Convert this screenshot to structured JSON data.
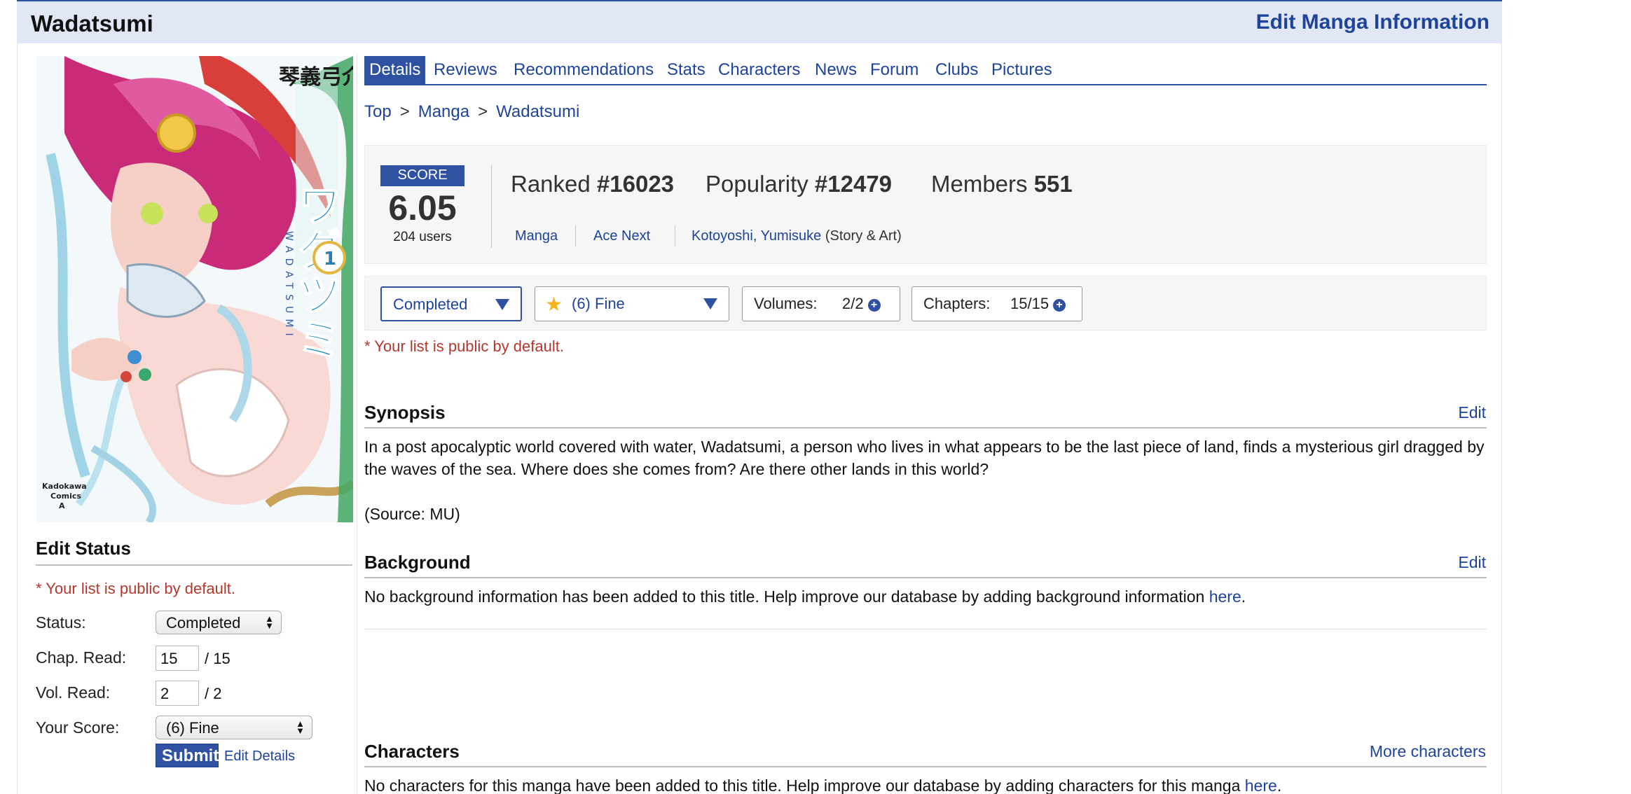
{
  "header": {
    "title": "Wadatsumi",
    "edit_link": "Edit Manga Information"
  },
  "cover": {
    "jp_title": "ワダツミ",
    "jp_author": "琴義弓介",
    "romaji": "WADATSUMI",
    "volume": "1",
    "publisher_mark": "Kadokawa Comics A",
    "colors": {
      "hair": "#c8287a",
      "skin": "#f5c6c0",
      "water": "#a9dcea",
      "title_green": "#37a85a"
    }
  },
  "tabs": [
    "Details",
    "Reviews",
    "Recommendations",
    "Stats",
    "Characters",
    "News",
    "Forum",
    "Clubs",
    "Pictures"
  ],
  "breadcrumb": [
    "Top",
    "Manga",
    "Wadatsumi"
  ],
  "stats": {
    "score_label": "SCORE",
    "score": "6.05",
    "users": "204 users",
    "ranked_label": "Ranked",
    "ranked": "#16023",
    "popularity_label": "Popularity",
    "popularity": "#12479",
    "members_label": "Members",
    "members": "551",
    "type": "Manga",
    "serialization": "Ace Next",
    "author": "Kotoyoshi, Yumisuke",
    "author_role": "(Story & Art)"
  },
  "list_bar": {
    "status": "Completed",
    "score": "(6) Fine",
    "volumes_label": "Volumes:",
    "volumes": "2/2",
    "chapters_label": "Chapters:",
    "chapters": "15/15"
  },
  "public_note": "* Your list is public by default.",
  "synopsis": {
    "title": "Synopsis",
    "edit": "Edit",
    "text": "In a post apocalyptic world covered with water, Wadatsumi, a person who lives in what appears to be the last piece of land, finds a mysterious girl dragged by the waves of the sea. Where does she comes from? Are there other lands in this world?",
    "source": "(Source: MU)"
  },
  "background": {
    "title": "Background",
    "edit": "Edit",
    "text": "No background information has been added to this title. Help improve our database by adding background information ",
    "link": "here",
    "end": "."
  },
  "characters": {
    "title": "Characters",
    "more": "More characters",
    "text": "No characters for this manga have been added to this title. Help improve our database by adding characters for this manga ",
    "link": "here",
    "end": "."
  },
  "edit_status": {
    "title": "Edit Status",
    "note": "* Your list is public by default.",
    "status_label": "Status:",
    "status_value": "Completed",
    "chap_label": "Chap. Read:",
    "chap_value": "15",
    "chap_total": "/ 15",
    "vol_label": "Vol. Read:",
    "vol_value": "2",
    "vol_total": "/ 2",
    "score_label": "Your Score:",
    "score_value": "(6) Fine",
    "submit": "Submit",
    "edit_details": "Edit Details"
  }
}
